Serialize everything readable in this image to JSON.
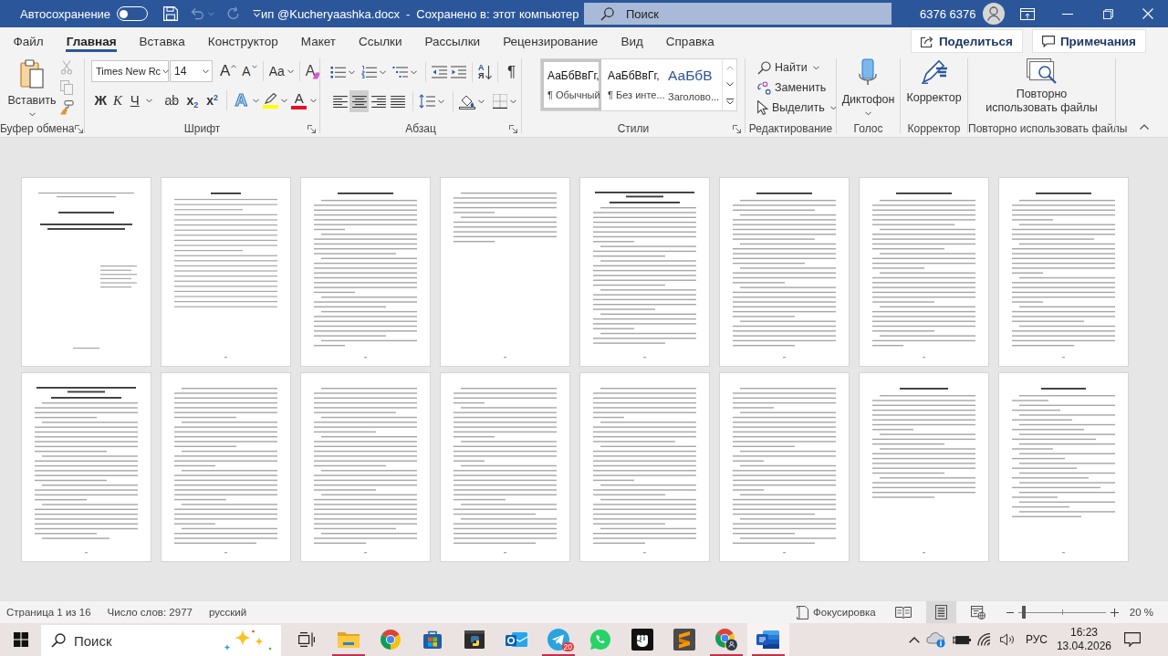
{
  "title_bar": {
    "autosave": {
      "label": "Автосохранение",
      "on": false
    },
    "undo": {
      "disabled": true
    },
    "redo": {
      "disabled": true
    },
    "document_name": "ип @Kucheryaashka.docx",
    "separator": "-",
    "save_status": "Сохранено в: этот компьютер",
    "search": {
      "placeholder": "Поиск"
    },
    "user_name": "6376 6376"
  },
  "tabs": [
    {
      "label": "Файл",
      "selected": false
    },
    {
      "label": "Главная",
      "selected": true
    },
    {
      "label": "Вставка",
      "selected": false
    },
    {
      "label": "Конструктор",
      "selected": false
    },
    {
      "label": "Макет",
      "selected": false
    },
    {
      "label": "Ссылки",
      "selected": false
    },
    {
      "label": "Рассылки",
      "selected": false
    },
    {
      "label": "Рецензирование",
      "selected": false
    },
    {
      "label": "Вид",
      "selected": false
    },
    {
      "label": "Справка",
      "selected": false
    }
  ],
  "share_button": "Поделиться",
  "comments_button": "Примечания",
  "ribbon": {
    "clipboard": {
      "label": "Буфер обмена",
      "paste": "Вставить",
      "cut": {
        "disabled": true
      },
      "copy": {
        "disabled": true
      }
    },
    "font": {
      "label": "Шрифт",
      "font_name": "Times New Rc",
      "font_size": "14",
      "grow": "A",
      "shrink": "A",
      "change_case": "Aa",
      "clear_format": "A",
      "format_buttons": [
        {
          "kind": "bold",
          "text": "Ж"
        },
        {
          "kind": "italic",
          "text": "К"
        },
        {
          "kind": "underline",
          "text": "Ч"
        },
        {
          "kind": "strike",
          "text": "ab"
        },
        {
          "kind": "subscript",
          "text": "x$_{2}$"
        },
        {
          "kind": "superscript",
          "text": "x$^{2}$"
        }
      ],
      "text_effects": "A",
      "highlight": {
        "color": "#ffff00"
      },
      "font_color": {
        "text": "A",
        "color": "#e81123"
      }
    },
    "paragraph": {
      "label": "Абзац",
      "sort": {
        "top": "А",
        "bottom": "Я"
      },
      "pilcrow": "¶",
      "alignments": [
        {
          "kind": "left",
          "selected": false
        },
        {
          "kind": "center",
          "selected": true
        },
        {
          "kind": "right",
          "selected": false
        },
        {
          "kind": "justify",
          "selected": false
        }
      ]
    },
    "styles": {
      "label": "Стили",
      "items": [
        {
          "kind": "normal",
          "preview": "АаБбВвГг,",
          "name": "¶ Обычный",
          "selected": true
        },
        {
          "kind": "no-spacing",
          "preview": "АаБбВвГг,",
          "name": "¶ Без инте...",
          "selected": false
        },
        {
          "kind": "heading",
          "preview": "АаБбВ",
          "name": "Заголово...",
          "selected": false
        }
      ]
    },
    "editing": {
      "label": "Редактирование",
      "find": "Найти",
      "replace": "Заменить",
      "select": "Выделить"
    },
    "voice": {
      "label": "Голос",
      "dictate": "Диктофон"
    },
    "editor": {
      "label": "Корректор",
      "button": "Корректор"
    },
    "reuse": {
      "label": "Повторно использовать файлы",
      "button": "Повторно использовать файлы"
    }
  },
  "document": {
    "pages": [
      {
        "kind": "cover"
      },
      {
        "kind": "contents"
      },
      {
        "kind": "section"
      },
      {
        "kind": "short"
      },
      {
        "kind": "chapter"
      },
      {
        "kind": "section"
      },
      {
        "kind": "section"
      },
      {
        "kind": "section"
      },
      {
        "kind": "chapter"
      },
      {
        "kind": "continued"
      },
      {
        "kind": "continued"
      },
      {
        "kind": "continued"
      },
      {
        "kind": "continued"
      },
      {
        "kind": "continued"
      },
      {
        "kind": "closing"
      },
      {
        "kind": "references"
      }
    ]
  },
  "status_bar": {
    "page": "Страница 1 из 16",
    "words": "Число слов: 2977",
    "language": "русский",
    "focus": "Фокусировка",
    "views": [
      {
        "kind": "read",
        "selected": false
      },
      {
        "kind": "print",
        "selected": true
      },
      {
        "kind": "web",
        "selected": false
      }
    ],
    "zoom": {
      "level": 0.06,
      "reading": "20 %"
    }
  },
  "taskbar": {
    "search": {
      "placeholder": "Поиск"
    },
    "apps": [
      {
        "kind": "task-view",
        "running": false,
        "active": false
      },
      {
        "kind": "explorer",
        "running": true,
        "active": false
      },
      {
        "kind": "chrome",
        "running": false,
        "active": false
      },
      {
        "kind": "store",
        "running": false,
        "active": false
      },
      {
        "kind": "terminal",
        "running": false,
        "active": false
      },
      {
        "kind": "outlook",
        "running": false,
        "active": false
      },
      {
        "kind": "telegram",
        "running": true,
        "active": false,
        "badge": "20"
      },
      {
        "kind": "whatsapp",
        "running": false,
        "active": false
      },
      {
        "kind": "fist",
        "running": false,
        "active": false
      },
      {
        "kind": "sublime",
        "running": false,
        "active": false
      },
      {
        "kind": "chrome-profile",
        "running": true,
        "active": false
      },
      {
        "kind": "word",
        "running": true,
        "active": true
      }
    ],
    "tray": {
      "language": "РУС",
      "time": "16:23",
      "date": "13.04.2026"
    }
  }
}
